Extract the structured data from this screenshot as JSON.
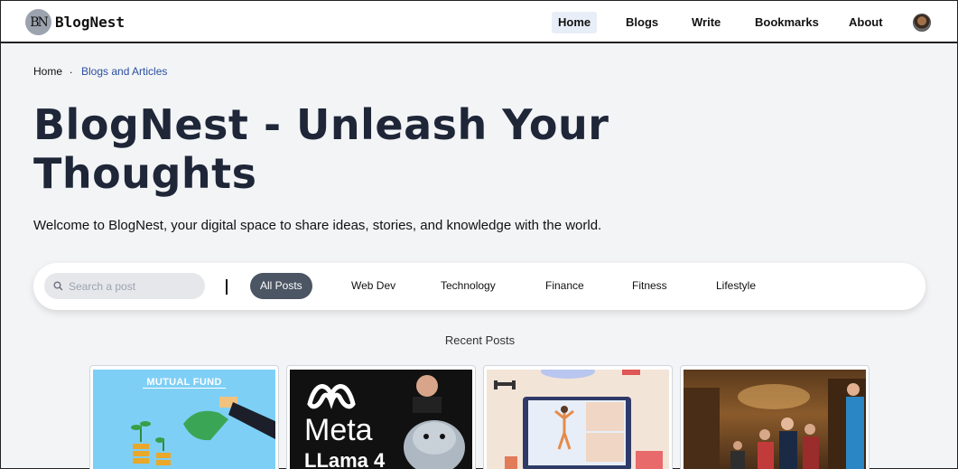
{
  "brand": {
    "logo_mark": "BN",
    "name": "BlogNest"
  },
  "nav": {
    "items": [
      {
        "label": "Home",
        "active": true
      },
      {
        "label": "Blogs"
      },
      {
        "label": "Write"
      },
      {
        "label": "Bookmarks"
      },
      {
        "label": "About"
      }
    ]
  },
  "breadcrumb": {
    "home": "Home",
    "separator": ".",
    "current": "Blogs and Articles"
  },
  "hero": {
    "title": "BlogNest - Unleash Your Thoughts",
    "subtitle": "Welcome to BlogNest, your digital space to share ideas, stories, and knowledge with the world."
  },
  "search": {
    "placeholder": "Search a post"
  },
  "categories": [
    "All Posts",
    "Web Dev",
    "Technology",
    "Finance",
    "Fitness",
    "Lifestyle"
  ],
  "recent_heading": "Recent Posts",
  "cards": [
    {
      "image_text": "MUTUAL FUND"
    },
    {
      "image_text": "Meta",
      "image_subtext": "LLama 4"
    },
    {
      "image_text": ""
    },
    {
      "image_text": ""
    }
  ],
  "colors": {
    "accent_active_chip": "#4b5563",
    "breadcrumb_link": "#2a4fa0",
    "headline": "#1e2638"
  }
}
